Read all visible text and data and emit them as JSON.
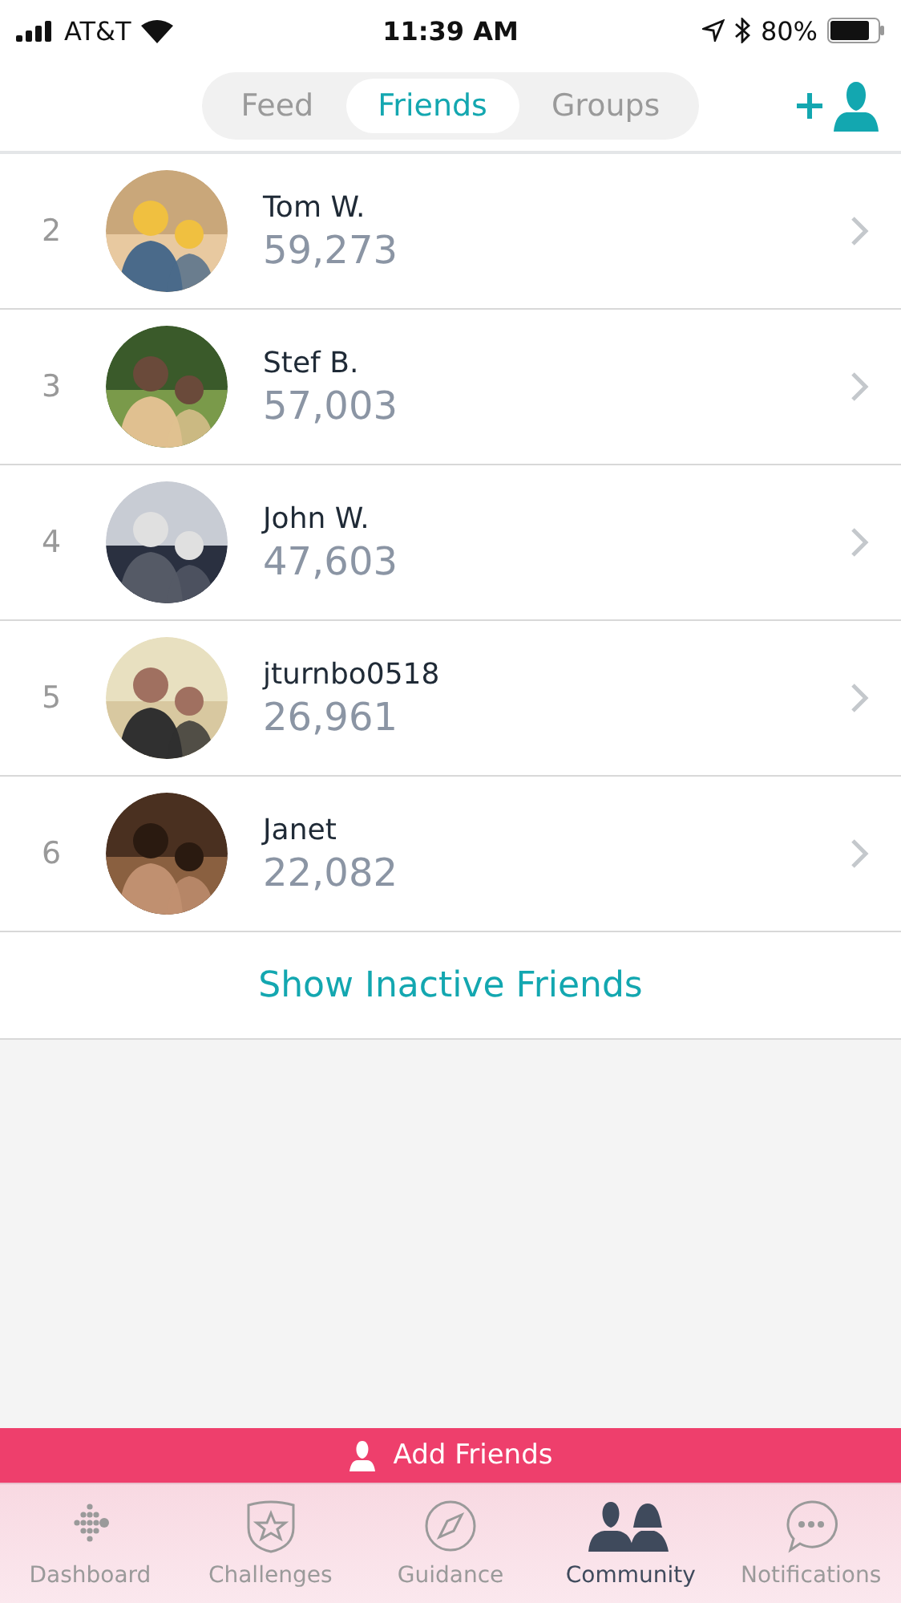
{
  "status_bar": {
    "carrier": "AT&T",
    "time": "11:39 AM",
    "battery": "80%"
  },
  "tabs": [
    {
      "label": "Feed",
      "selected": false
    },
    {
      "label": "Friends",
      "selected": true
    },
    {
      "label": "Groups",
      "selected": false
    }
  ],
  "friends": [
    {
      "rank": "2",
      "name": "Tom W.",
      "steps": "59,273"
    },
    {
      "rank": "3",
      "name": "Stef B.",
      "steps": "57,003"
    },
    {
      "rank": "4",
      "name": "John W.",
      "steps": "47,603"
    },
    {
      "rank": "5",
      "name": "jturnbo0518",
      "steps": "26,961"
    },
    {
      "rank": "6",
      "name": "Janet",
      "steps": "22,082"
    }
  ],
  "show_inactive": "Show Inactive Friends",
  "add_friends": "Add Friends",
  "nav": [
    {
      "label": "Dashboard",
      "kind": "dashboard",
      "selected": false
    },
    {
      "label": "Challenges",
      "kind": "challenges",
      "selected": false
    },
    {
      "label": "Guidance",
      "kind": "guidance",
      "selected": false
    },
    {
      "label": "Community",
      "kind": "community",
      "selected": true
    },
    {
      "label": "Notifications",
      "kind": "notifications",
      "selected": false
    }
  ]
}
